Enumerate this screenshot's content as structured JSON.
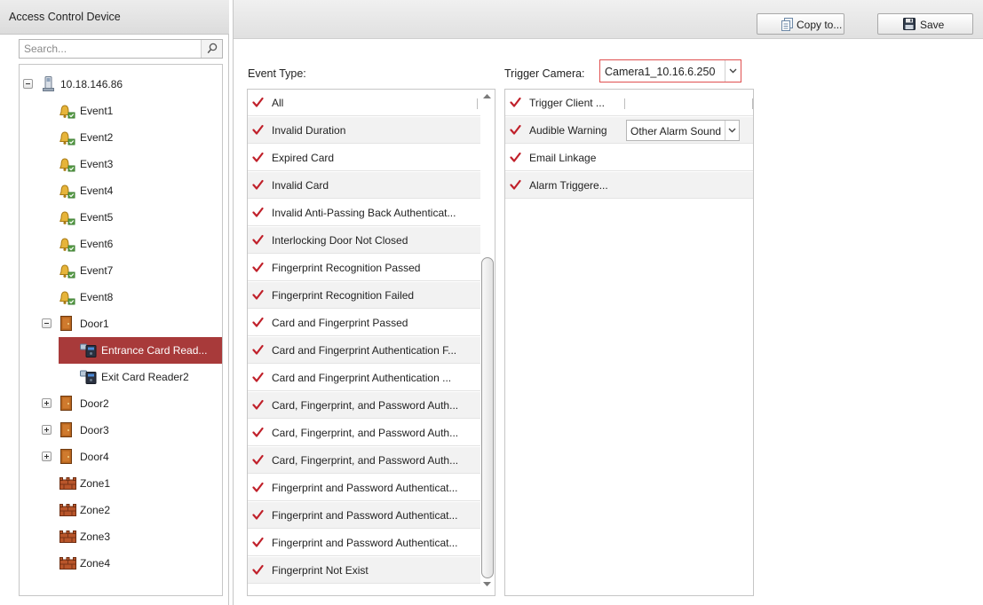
{
  "left_panel": {
    "title": "Access Control Device",
    "search": {
      "placeholder": "Search..."
    },
    "tree": [
      {
        "id": "device",
        "label": "10.18.146.86",
        "kind": "device",
        "expander": "minus"
      },
      {
        "id": "event1",
        "label": "Event1",
        "kind": "event"
      },
      {
        "id": "event2",
        "label": "Event2",
        "kind": "event"
      },
      {
        "id": "event3",
        "label": "Event3",
        "kind": "event"
      },
      {
        "id": "event4",
        "label": "Event4",
        "kind": "event"
      },
      {
        "id": "event5",
        "label": "Event5",
        "kind": "event"
      },
      {
        "id": "event6",
        "label": "Event6",
        "kind": "event"
      },
      {
        "id": "event7",
        "label": "Event7",
        "kind": "event"
      },
      {
        "id": "event8",
        "label": "Event8",
        "kind": "event"
      },
      {
        "id": "door1",
        "label": "Door1",
        "kind": "door",
        "expander": "minus"
      },
      {
        "id": "entrance-reader",
        "label": "Entrance Card Read...",
        "kind": "reader",
        "selected": true
      },
      {
        "id": "exit-reader",
        "label": "Exit Card Reader2",
        "kind": "reader"
      },
      {
        "id": "door2",
        "label": "Door2",
        "kind": "door",
        "expander": "plus"
      },
      {
        "id": "door3",
        "label": "Door3",
        "kind": "door",
        "expander": "plus"
      },
      {
        "id": "door4",
        "label": "Door4",
        "kind": "door",
        "expander": "plus"
      },
      {
        "id": "zone1",
        "label": "Zone1",
        "kind": "zone"
      },
      {
        "id": "zone2",
        "label": "Zone2",
        "kind": "zone"
      },
      {
        "id": "zone3",
        "label": "Zone3",
        "kind": "zone"
      },
      {
        "id": "zone4",
        "label": "Zone4",
        "kind": "zone"
      }
    ]
  },
  "toolbar": {
    "copy_label": "Copy to...",
    "copy_icon": "copy-icon",
    "save_label": "Save",
    "save_icon": "floppy-disk-icon"
  },
  "event_type": {
    "label": "Event Type:",
    "items": [
      {
        "label": "All",
        "checked": true
      },
      {
        "label": "Invalid Duration",
        "checked": true
      },
      {
        "label": "Expired Card",
        "checked": true
      },
      {
        "label": "Invalid Card",
        "checked": true
      },
      {
        "label": "Invalid Anti-Passing Back Authenticat...",
        "checked": true
      },
      {
        "label": "Interlocking Door Not Closed",
        "checked": true
      },
      {
        "label": "Fingerprint Recognition Passed",
        "checked": true
      },
      {
        "label": "Fingerprint Recognition Failed",
        "checked": true
      },
      {
        "label": "Card and Fingerprint Passed",
        "checked": true
      },
      {
        "label": "Card and Fingerprint Authentication F...",
        "checked": true
      },
      {
        "label": "Card and Fingerprint Authentication ...",
        "checked": true
      },
      {
        "label": "Card, Fingerprint, and Password Auth...",
        "checked": true
      },
      {
        "label": "Card, Fingerprint, and Password Auth...",
        "checked": true
      },
      {
        "label": "Card, Fingerprint, and Password Auth...",
        "checked": true
      },
      {
        "label": "Fingerprint and Password Authenticat...",
        "checked": true
      },
      {
        "label": "Fingerprint and Password Authenticat...",
        "checked": true
      },
      {
        "label": "Fingerprint and Password Authenticat...",
        "checked": true
      },
      {
        "label": "Fingerprint Not Exist",
        "checked": true
      }
    ]
  },
  "trigger_camera": {
    "label": "Trigger Camera:",
    "selected": "Camera1_10.16.6.250"
  },
  "linkage": {
    "items": [
      {
        "label": "Trigger Client ...",
        "checked": true
      },
      {
        "label": "Audible Warning",
        "checked": true,
        "sound": "Other Alarm Sound"
      },
      {
        "label": "Email Linkage",
        "checked": true
      },
      {
        "label": "Alarm Triggere...",
        "checked": true
      }
    ]
  },
  "colors": {
    "selection": "#a83a3a",
    "check": "#c0202a",
    "select_border": "#e05050"
  }
}
